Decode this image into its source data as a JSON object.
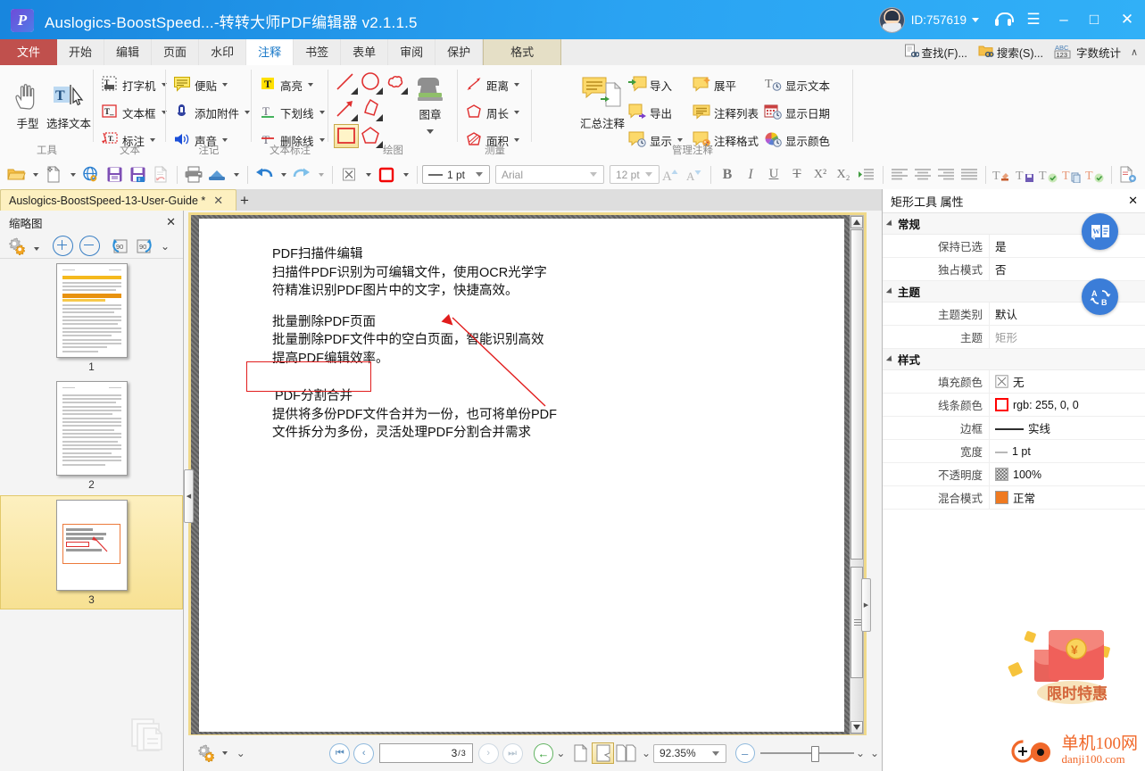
{
  "titlebar": {
    "title": "Auslogics-BoostSpeed...-转转大师PDF编辑器 v2.1.1.5",
    "user_id": "ID:757619",
    "logo_letter": "P",
    "minimize": "–",
    "maximize": "□",
    "close": "✕",
    "menu": "☰"
  },
  "tabs": [
    {
      "label": "文件",
      "kind": "file"
    },
    {
      "label": "开始",
      "kind": "normal"
    },
    {
      "label": "编辑",
      "kind": "normal"
    },
    {
      "label": "页面",
      "kind": "normal"
    },
    {
      "label": "水印",
      "kind": "normal"
    },
    {
      "label": "注释",
      "kind": "active"
    },
    {
      "label": "书签",
      "kind": "normal"
    },
    {
      "label": "表单",
      "kind": "normal"
    },
    {
      "label": "审阅",
      "kind": "normal"
    },
    {
      "label": "保护",
      "kind": "normal"
    },
    {
      "label": "格式",
      "kind": "context"
    }
  ],
  "tabbar_right": [
    {
      "label": "查找(F)...",
      "icon": "find-icon"
    },
    {
      "label": "搜索(S)...",
      "icon": "search-folder-icon"
    },
    {
      "label": "字数统计",
      "icon": "abc-123-icon"
    }
  ],
  "ribbon": {
    "groups": [
      {
        "name": "工具",
        "big_buttons": [
          {
            "label": "手型",
            "icon": "hand-icon"
          },
          {
            "label": "选择文本",
            "icon": "select-text-icon"
          }
        ],
        "small_buttons": []
      },
      {
        "name": "文本",
        "big_buttons": [],
        "small_buttons": [
          {
            "label": "打字机",
            "icon": "typewriter-icon",
            "dropdown": true
          },
          {
            "label": "文本框",
            "icon": "textbox-icon",
            "dropdown": true
          },
          {
            "label": "标注",
            "icon": "callout-icon",
            "dropdown": true
          }
        ]
      },
      {
        "name": "注记",
        "big_buttons": [],
        "small_buttons": [
          {
            "label": "便贴",
            "icon": "sticky-note-icon",
            "dropdown": true
          },
          {
            "label": "添加附件",
            "icon": "attachment-icon",
            "dropdown": true
          },
          {
            "label": "声音",
            "icon": "sound-icon",
            "dropdown": true
          }
        ]
      },
      {
        "name": "文本标注",
        "big_buttons": [],
        "small_buttons": [
          {
            "label": "高亮",
            "icon": "highlight-icon",
            "dropdown": true
          },
          {
            "label": "下划线",
            "icon": "underline-icon",
            "dropdown": true
          },
          {
            "label": "删除线",
            "icon": "strikethrough-icon",
            "dropdown": true
          }
        ]
      },
      {
        "name": "绘图",
        "big_buttons": [
          {
            "label": "图章",
            "icon": "stamp-icon",
            "dropdown": true
          }
        ],
        "shape_tools": [
          "line-icon",
          "ellipse-icon",
          "cloud-icon",
          "arrow-icon",
          "polyline-icon",
          "rectangle-icon",
          "polygon-icon"
        ]
      },
      {
        "name": "测量",
        "big_buttons": [],
        "small_buttons": [
          {
            "label": "距离",
            "icon": "distance-icon",
            "dropdown": true
          },
          {
            "label": "周长",
            "icon": "perimeter-icon",
            "dropdown": true
          },
          {
            "label": "面积",
            "icon": "area-icon",
            "dropdown": true
          }
        ]
      },
      {
        "name": "管理注释",
        "big_buttons": [
          {
            "label": "汇总注释",
            "icon": "summarize-comments-icon"
          }
        ],
        "small_buttons": [
          {
            "label": "导入",
            "icon": "import-icon"
          },
          {
            "label": "导出",
            "icon": "export-icon"
          },
          {
            "label": "显示",
            "icon": "show-icon",
            "dropdown": true
          },
          {
            "label": "展平",
            "icon": "flatten-icon"
          },
          {
            "label": "注释列表",
            "icon": "comment-list-icon"
          },
          {
            "label": "注释格式",
            "icon": "comment-format-icon"
          },
          {
            "label": "显示文本",
            "icon": "show-text-icon"
          },
          {
            "label": "显示日期",
            "icon": "show-date-icon"
          },
          {
            "label": "显示颜色",
            "icon": "show-color-icon"
          }
        ]
      }
    ]
  },
  "format_toolbar": {
    "icons": [
      "open-folder-icon",
      "new-doc-icon",
      "web-link-icon",
      "save-icon",
      "save-as-icon",
      "revert-icon",
      "print-icon",
      "scanner-icon",
      "undo-icon",
      "redo-icon",
      "no-fill-icon",
      "line-color-icon"
    ],
    "line_width": "1 pt",
    "font_family": "Arial",
    "font_size": "12 pt",
    "bold": "B",
    "italic": "I",
    "underline": "U",
    "strike": "T",
    "superscript": "X²",
    "subscript": "X₂",
    "indent": "indent-icon",
    "align": [
      "align-left-icon",
      "align-center-icon",
      "align-right-icon",
      "align-justify-icon"
    ],
    "text_tools": [
      "text-clear-icon",
      "text-save-icon",
      "text-check-icon",
      "text-copy-icon",
      "text-apply-icon",
      "text-settings-icon"
    ]
  },
  "doc_tabs": {
    "active": "Auslogics-BoostSpeed-13-User-Guide *",
    "close": "✕",
    "new_tab": "+"
  },
  "left_panel": {
    "title": "缩略图",
    "close": "✕",
    "tools": [
      "settings-gear-icon",
      "zoom-in-icon",
      "zoom-out-icon",
      "rotate-left-90-icon",
      "rotate-right-90-icon",
      "more-chevron-icon"
    ],
    "rotate_label": "90",
    "pages": [
      {
        "number": "1",
        "selected": false
      },
      {
        "number": "2",
        "selected": false
      },
      {
        "number": "3",
        "selected": true
      }
    ]
  },
  "document": {
    "blocks": [
      [
        "PDF扫描件编辑",
        "扫描件PDF识别为可编辑文件，使用OCR光学字",
        "符精准识别PDF图片中的文字，快捷高效。"
      ],
      [
        "批量删除PDF页面",
        "批量删除PDF文件中的空白页面，智能识别高效",
        "提高PDF编辑效率。"
      ],
      [
        "PDF分割合并",
        "提供将多份PDF文件合并为一份，也可将单份PDF",
        "文件拆分为多份，灵活处理PDF分割合并需求"
      ]
    ],
    "annotation_box_color": "#e11d1d",
    "annotation_arrow_color": "#e11d1d"
  },
  "statusbar": {
    "settings_icon": "gear-icon",
    "first_page": "⏮",
    "prev_page": "‹",
    "page_current": "3",
    "page_total": "3",
    "page_separator": "/",
    "next_page": "›",
    "last_page": "⏭",
    "back": "←",
    "view_single": "single-page-icon",
    "view_continuous": "continuous-page-icon",
    "view_facing": "facing-page-icon",
    "zoom_value": "92.35%",
    "zoom_out": "–",
    "zoom_in": "+"
  },
  "right_panel": {
    "title": "矩形工具 属性",
    "close": "✕",
    "sections": [
      {
        "name": "常规",
        "rows": [
          {
            "key": "保持已选",
            "value": "是",
            "muted": false
          },
          {
            "key": "独占模式",
            "value": "否",
            "muted": false
          }
        ]
      },
      {
        "name": "主题",
        "rows": [
          {
            "key": "主题类别",
            "value": "默认",
            "muted": false
          },
          {
            "key": "主题",
            "value": "矩形",
            "muted": true
          }
        ]
      },
      {
        "name": "样式",
        "rows": [
          {
            "key": "填充颜色",
            "value": "无",
            "swatch": "none",
            "muted": false
          },
          {
            "key": "线条颜色",
            "value": "rgb: 255, 0, 0",
            "swatch": "#ff0000",
            "muted": false
          },
          {
            "key": "边框",
            "value": "实线",
            "swatch": "line",
            "muted": false
          },
          {
            "key": "宽度",
            "value": "1 pt",
            "swatch": "line-thin",
            "muted": false
          },
          {
            "key": "不透明度",
            "value": "100%",
            "swatch": "checker",
            "muted": false
          },
          {
            "key": "混合模式",
            "value": "正常",
            "swatch": "#ef7a21",
            "muted": false
          }
        ]
      }
    ],
    "float_buttons": [
      {
        "name": "word-convert-button",
        "label": "W"
      },
      {
        "name": "translate-button",
        "label": "A→B"
      }
    ]
  },
  "promo": {
    "badge_text": "限时特惠",
    "envelope_symbol": "¥",
    "brand_line1": "单机100网",
    "brand_line2": "danji100.com"
  },
  "colors": {
    "titlebar": "#2196f3",
    "file_tab": "#c0504d",
    "context_tab": "#e5dfc6",
    "accent_red": "#e11d1d",
    "doc_tab": "#fdf0c0",
    "selection": "#f7e193"
  }
}
